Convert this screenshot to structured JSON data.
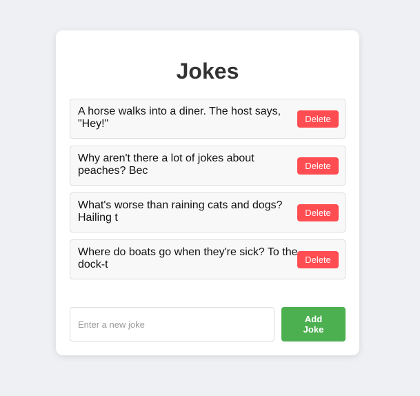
{
  "page": {
    "title": "Jokes"
  },
  "jokes": [
    {
      "text": "A horse walks into a diner. The host says, \"Hey!\"",
      "delete_label": "Delete"
    },
    {
      "text": "Why aren't there a lot of jokes about peaches? Bec",
      "delete_label": "Delete"
    },
    {
      "text": "What's worse than raining cats and dogs? Hailing t",
      "delete_label": "Delete"
    },
    {
      "text": "Where do boats go when they're sick? To the dock-t",
      "delete_label": "Delete"
    }
  ],
  "form": {
    "input_value": "",
    "input_placeholder": "Enter a new joke",
    "add_label": "Add Joke"
  },
  "colors": {
    "background": "#eef0f4",
    "card": "#ffffff",
    "delete_button": "#ff4d52",
    "add_button": "#4caf50",
    "joke_item_bg": "#f8f8f8"
  }
}
